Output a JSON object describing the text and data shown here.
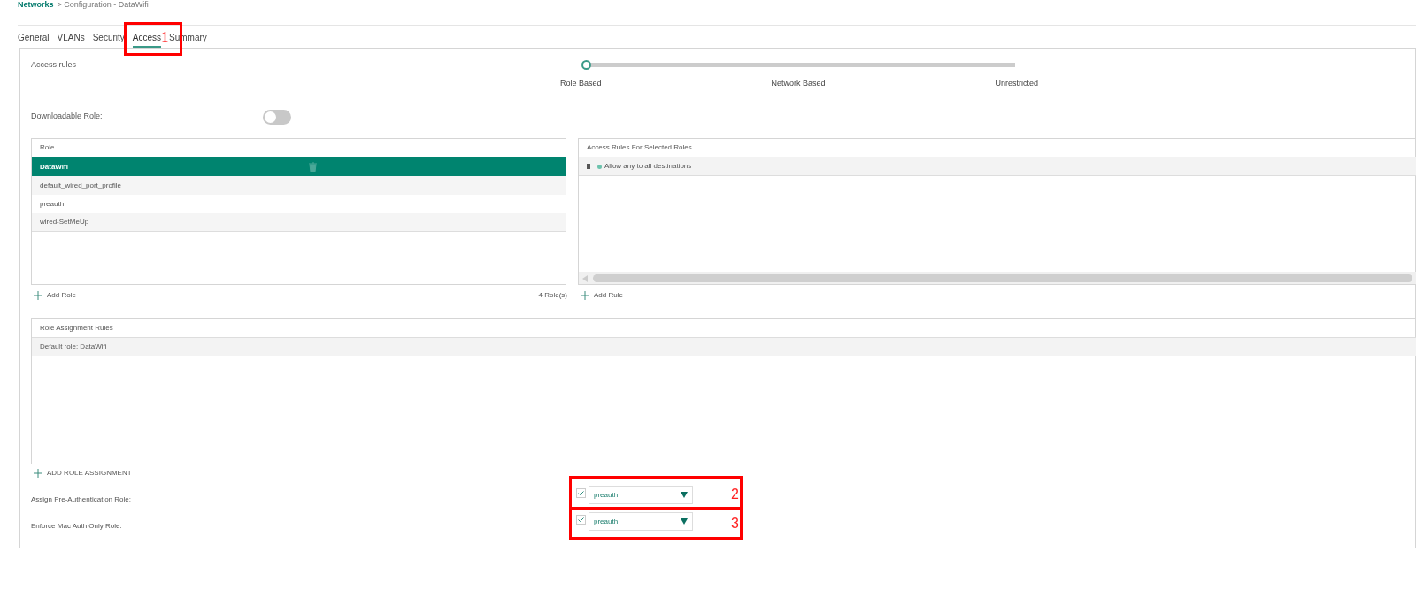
{
  "breadcrumb": {
    "link": "Networks",
    "rest": "> Configuration - DataWifi"
  },
  "tabs": [
    {
      "label": "General",
      "selected": false
    },
    {
      "label": "VLANs",
      "selected": false
    },
    {
      "label": "Security",
      "selected": false
    },
    {
      "label": "Access",
      "selected": true
    },
    {
      "label": "Summary",
      "selected": false
    }
  ],
  "access_rules": {
    "label": "Access rules",
    "level": 0,
    "stops": [
      "Role Based",
      "Network Based",
      "Unrestricted"
    ]
  },
  "downloadable_role": {
    "label": "Downloadable Role:",
    "on": false
  },
  "roles": {
    "header": "Role",
    "rows": [
      {
        "name": "DataWifi",
        "selected": true
      },
      {
        "name": "default_wired_port_profile",
        "selected": false
      },
      {
        "name": "preauth",
        "selected": false
      },
      {
        "name": "wired-SetMeUp",
        "selected": false
      }
    ],
    "add": "Add Role",
    "count": "4 Role(s)"
  },
  "rules": {
    "header": "Access Rules For Selected Roles",
    "rows": [
      "Allow any to all destinations"
    ],
    "add": "Add Rule"
  },
  "assignment": {
    "header": "Role Assignment Rules",
    "default": "Default role: DataWifi",
    "add": "ADD ROLE ASSIGNMENT"
  },
  "options": [
    {
      "label": "Assign Pre-Authentication Role:",
      "checked": true,
      "value": "preauth"
    },
    {
      "label": "Enforce Mac Auth Only Role:",
      "checked": true,
      "value": "preauth"
    }
  ],
  "callouts": [
    "1",
    "2",
    "3"
  ]
}
